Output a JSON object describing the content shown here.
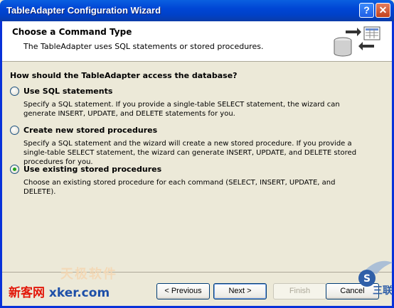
{
  "window": {
    "title": "TableAdapter Configuration Wizard",
    "help_glyph": "?",
    "close_glyph": "✕"
  },
  "header": {
    "title": "Choose a Command Type",
    "subtitle": "The TableAdapter uses SQL statements or stored procedures."
  },
  "question": "How should the TableAdapter access the database?",
  "options": [
    {
      "label": "Use SQL statements",
      "description": "Specify a SQL statement. If you provide a single-table SELECT statement, the wizard can generate INSERT, UPDATE, and DELETE statements for you.",
      "checked": false
    },
    {
      "label": "Create new stored procedures",
      "description": "Specify a SQL statement and the wizard will create a new stored procedure. If you provide a single-table SELECT statement, the wizard can generate INSERT, UPDATE, and DELETE stored procedures for you.",
      "checked": false
    },
    {
      "label": "Use existing stored procedures",
      "description": "Choose an existing stored procedure for each command (SELECT, INSERT, UPDATE, and DELETE).",
      "checked": true
    }
  ],
  "buttons": {
    "previous": "< Previous",
    "next": "Next >",
    "finish": "Finish",
    "cancel": "Cancel"
  },
  "watermarks": {
    "left_cn": "新客网",
    "left_en": "xker.com",
    "top": "天极软件",
    "right": "三联"
  },
  "colors": {
    "titlebar": "#0046d5",
    "dialog_bg": "#ece9d8",
    "header_bg": "#ffffff",
    "selected_radio": "#22a31b",
    "watermark_red": "#e2180a"
  }
}
